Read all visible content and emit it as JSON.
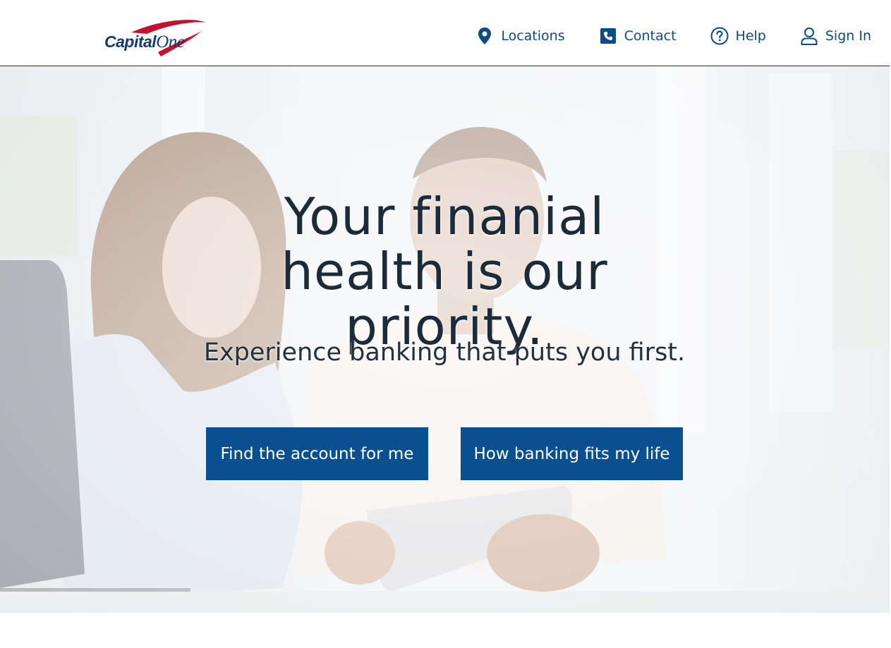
{
  "brand": {
    "name_part1": "Capital",
    "name_part2": "One",
    "accent": "#0a4f8f",
    "swoosh": "#c8102e"
  },
  "nav": [
    {
      "label": "Locations",
      "icon": "map-pin-icon"
    },
    {
      "label": "Contact",
      "icon": "phone-icon"
    },
    {
      "label": "Help",
      "icon": "question-circle-icon"
    },
    {
      "label": "Sign In",
      "icon": "user-icon"
    }
  ],
  "hero": {
    "title": "Your finanial health is our priority.",
    "subtitle": "Experience banking that puts you first.",
    "primary_cta": "Find the account for me",
    "secondary_cta": "How banking fits my life"
  }
}
